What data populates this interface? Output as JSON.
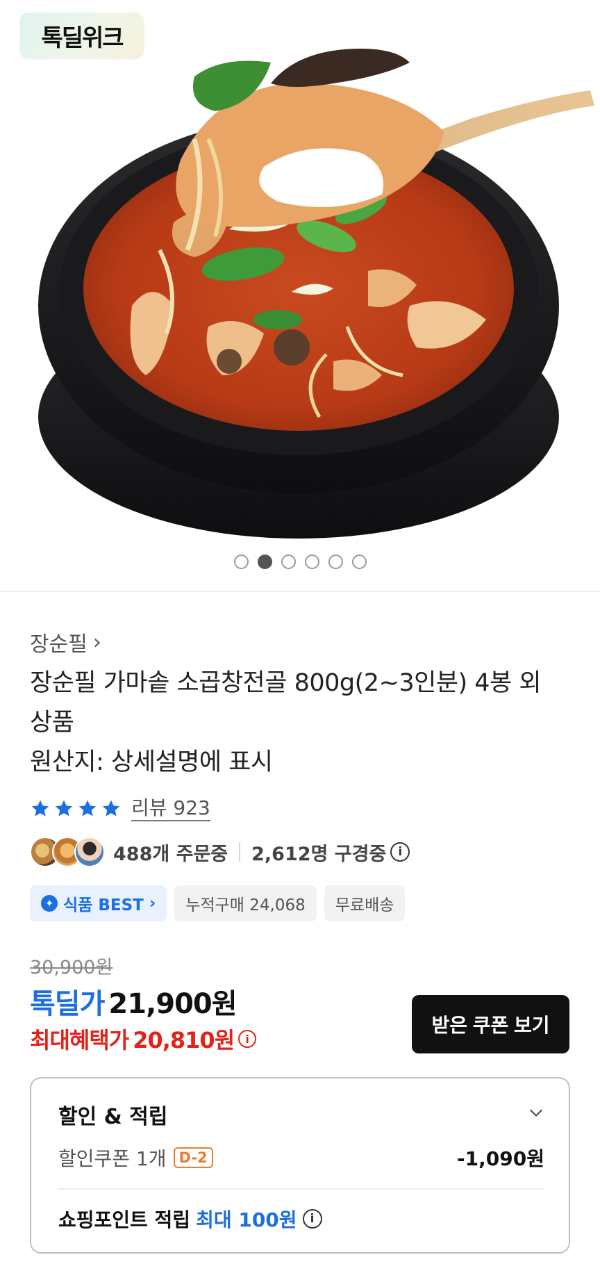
{
  "hero": {
    "badge_text": "톡딜위크",
    "image_icon": "stew-in-stone-bowl-photo",
    "carousel_count": 6,
    "carousel_active_index": 1
  },
  "product": {
    "brand": "장순필",
    "brand_chevron": "›",
    "title_line1": "장순필 가마솥 소곱창전골 800g(2~3인분) 4봉 외",
    "title_line2": "상품",
    "title_line3": "원산지: 상세설명에 표시",
    "rating_stars": 4,
    "review_text": "리뷰 923"
  },
  "social": {
    "orders_text": "488개 주문중",
    "viewers_text": "2,612명 구경중",
    "info_icon": "ⓘ"
  },
  "tags": {
    "best_label": "식품 BEST",
    "best_chevron": "›",
    "cumulative": "누적구매 24,068",
    "shipping": "무료배송"
  },
  "price": {
    "original": "30,900원",
    "sale_label": "톡딜가",
    "sale_price": "21,900원",
    "max_label": "최대혜택가",
    "max_price": "20,810원",
    "info_icon": "i",
    "coupon_button": "받은 쿠폰 보기"
  },
  "benefit": {
    "title": "할인 & 적립",
    "coupon_label": "할인쿠폰 1개",
    "dday": "D-2",
    "coupon_amount": "-1,090원",
    "point_label": "쇼핑포인트 적립",
    "point_value": "최대 100원",
    "point_info": "i"
  },
  "colors": {
    "accent_blue": "#1c6fe0",
    "accent_red": "#e2231a",
    "dday_orange": "#ef7b2e"
  }
}
